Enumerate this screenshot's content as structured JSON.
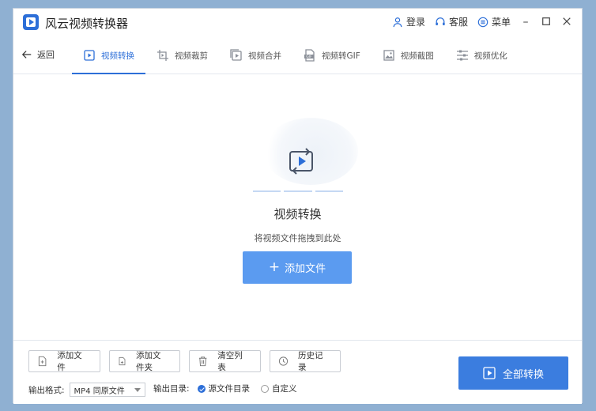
{
  "app": {
    "title": "风云视频转换器"
  },
  "title_actions": {
    "login": "登录",
    "service": "客服",
    "menu": "菜单"
  },
  "nav": {
    "back": "返回",
    "tabs": [
      {
        "label": "视频转换",
        "icon": "video-convert-icon",
        "active": true
      },
      {
        "label": "视频裁剪",
        "icon": "video-crop-icon",
        "active": false
      },
      {
        "label": "视频合并",
        "icon": "video-merge-icon",
        "active": false
      },
      {
        "label": "视频转GIF",
        "icon": "gif-icon",
        "active": false
      },
      {
        "label": "视频截图",
        "icon": "screenshot-icon",
        "active": false
      },
      {
        "label": "视频优化",
        "icon": "optimize-sliders-icon",
        "active": false
      }
    ]
  },
  "dropzone": {
    "title": "视频转换",
    "subtitle": "将视频文件拖拽到此处",
    "add_button": "添加文件"
  },
  "footer": {
    "buttons": {
      "add_file": "添加文件",
      "add_folder": "添加文件夹",
      "clear_list": "清空列表",
      "history": "历史记录"
    },
    "format_label": "输出格式:",
    "format_value": "MP4 同原文件",
    "output_label": "输出目录:",
    "output_options": {
      "source": "源文件目录",
      "custom": "自定义"
    },
    "convert_all": "全部转换"
  },
  "colors": {
    "accent": "#2d6fd8",
    "primary_button": "#5b9bf0",
    "convert_button": "#3b7ddf",
    "background": "#8fb0d2"
  }
}
